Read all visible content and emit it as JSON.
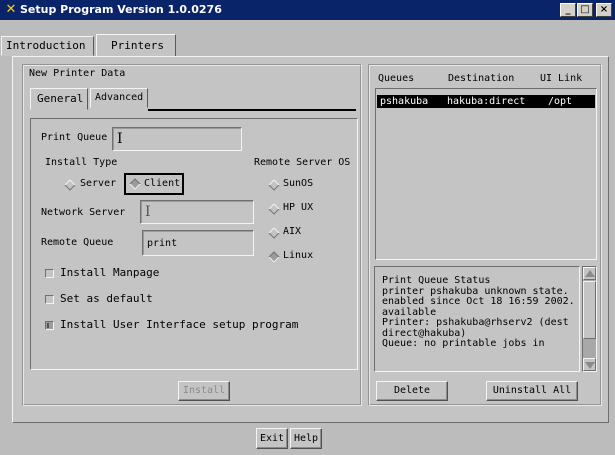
{
  "window": {
    "title": "Setup Program Version 1.0.0276",
    "minimize_glyph": "_",
    "maximize_glyph": "□",
    "close_glyph": "×"
  },
  "top_tabs": [
    {
      "label": "Introduction",
      "active": false
    },
    {
      "label": "Printers",
      "active": true
    }
  ],
  "left_panel": {
    "group_title": "New Printer Data",
    "tabs": [
      {
        "label": "General",
        "active": true
      },
      {
        "label": "Advanced",
        "active": false
      }
    ],
    "print_queue_label": "Print Queue",
    "print_queue_value": "I",
    "install_type_label": "Install Type",
    "install_type_options": [
      {
        "label": "Server",
        "selected": false
      },
      {
        "label": "Client",
        "selected": true
      }
    ],
    "remote_os_label": "Remote Server OS",
    "remote_os_options": [
      {
        "label": "SunOS",
        "selected": false
      },
      {
        "label": "HP UX",
        "selected": false
      },
      {
        "label": "AIX",
        "selected": false
      },
      {
        "label": "Linux",
        "selected": true
      }
    ],
    "network_server_label": "Network Server",
    "network_server_value": "I",
    "remote_queue_label": "Remote Queue",
    "remote_queue_value": "print",
    "checkboxes": [
      {
        "label": "Install Manpage",
        "checked": false
      },
      {
        "label": "Set as default",
        "checked": false
      },
      {
        "label": "Install User Interface setup program",
        "checked": true
      }
    ],
    "install_button": "Install"
  },
  "right_panel": {
    "columns": [
      "Queues",
      "Destination",
      "UI Link"
    ],
    "rows": [
      {
        "queue": "pshakuba",
        "destination": "hakuba:direct",
        "ui_link": "/opt"
      }
    ],
    "status_lines": [
      "Print Queue Status",
      "printer pshakuba unknown state.",
      "enabled since Oct 18 16:59 2002.",
      "available",
      "Printer: pshakuba@rhserv2 (dest",
      "direct@hakuba)",
      "Queue: no printable jobs in"
    ],
    "delete_button": "Delete",
    "uninstall_all_button": "Uninstall All"
  },
  "footer": {
    "exit_button": "Exit",
    "help_button": "Help"
  },
  "colors": {
    "titlebar": "#0a246a",
    "title_icon": "#ffd200",
    "background": "#bcbcbc",
    "panel": "#c4c4c4",
    "selection": "#000000"
  }
}
